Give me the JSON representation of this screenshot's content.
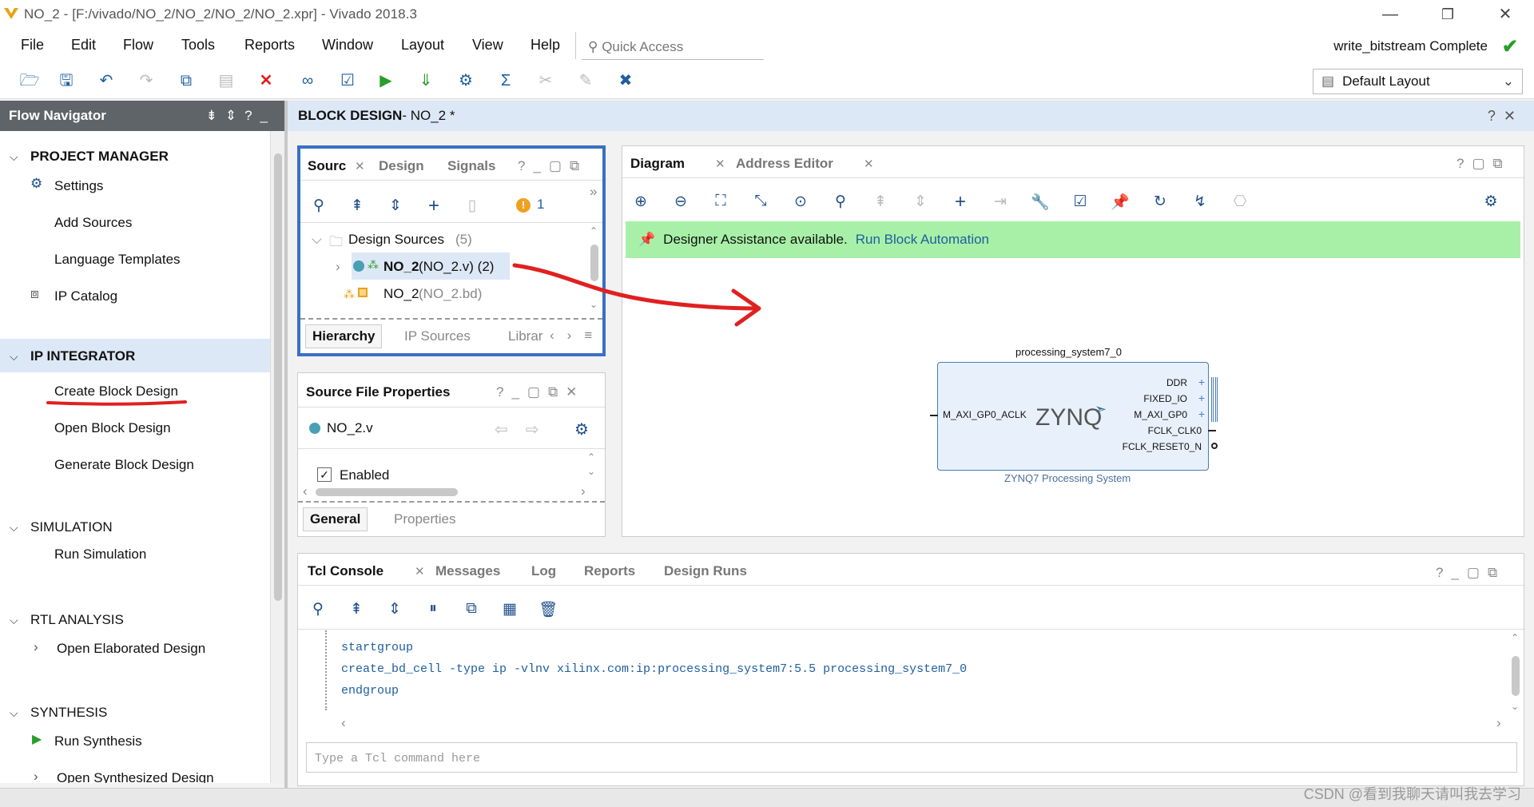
{
  "window": {
    "title": "NO_2 - [F:/vivado/NO_2/NO_2/NO_2/NO_2.xpr] - Vivado 2018.3"
  },
  "menu": [
    "File",
    "Edit",
    "Flow",
    "Tools",
    "Reports",
    "Window",
    "Layout",
    "View",
    "Help"
  ],
  "quick_access": "Quick Access",
  "status": "write_bitstream Complete",
  "layout_select": "Default Layout",
  "flow_nav": {
    "title": "Flow Navigator",
    "project_manager": "PROJECT MANAGER",
    "settings": "Settings",
    "add_sources": "Add Sources",
    "language_templates": "Language Templates",
    "ip_catalog": "IP Catalog",
    "ip_integrator": "IP INTEGRATOR",
    "create_bd": "Create Block Design",
    "open_bd": "Open Block Design",
    "generate_bd": "Generate Block Design",
    "simulation": "SIMULATION",
    "run_sim": "Run Simulation",
    "rtl": "RTL ANALYSIS",
    "open_elab": "Open Elaborated Design",
    "synthesis": "SYNTHESIS",
    "run_synth": "Run Synthesis",
    "open_synth": "Open Synthesized Design"
  },
  "bd_header": {
    "label": "BLOCK DESIGN",
    "name": " - NO_2 *"
  },
  "sources": {
    "tabs": [
      "Sourc",
      "Design",
      "Signals"
    ],
    "warn_count": "1",
    "root": "Design Sources",
    "root_count": "(5)",
    "item1_name": "NO_2",
    "item1_file": "(NO_2.v) (2)",
    "item2_name": "NO_2",
    "item2_file": "(NO_2.bd)",
    "bottom_tabs": [
      "Hierarchy",
      "IP Sources",
      "Librar"
    ]
  },
  "props": {
    "title": "Source File Properties",
    "file": "NO_2.v",
    "enabled": "Enabled",
    "tabs": [
      "General",
      "Properties"
    ]
  },
  "diagram": {
    "tabs": [
      "Diagram",
      "Address Editor"
    ],
    "assist": "Designer Assistance available.",
    "assist_link": "Run Block Automation",
    "block_name": "processing_system7_0",
    "block_caption": "ZYNQ7 Processing System",
    "logo": "ZYNQ",
    "in_port": "M_AXI_GP0_ACLK",
    "out_ports": [
      "DDR",
      "FIXED_IO",
      "M_AXI_GP0",
      "FCLK_CLK0",
      "FCLK_RESET0_N"
    ]
  },
  "console": {
    "tabs": [
      "Tcl Console",
      "Messages",
      "Log",
      "Reports",
      "Design Runs"
    ],
    "lines": [
      "startgroup",
      "create_bd_cell -type ip -vlnv xilinx.com:ip:processing_system7:5.5 processing_system7_0",
      "endgroup"
    ],
    "placeholder": "Type a Tcl command here"
  },
  "watermark": "CSDN @看到我聊天请叫我去学习",
  "colors": {
    "accent": "#1f5fa0",
    "nav_header": "#5e6468",
    "assist_bar": "#a8f0a8",
    "highlight": "#dde8f6",
    "annotation": "#e02020"
  }
}
